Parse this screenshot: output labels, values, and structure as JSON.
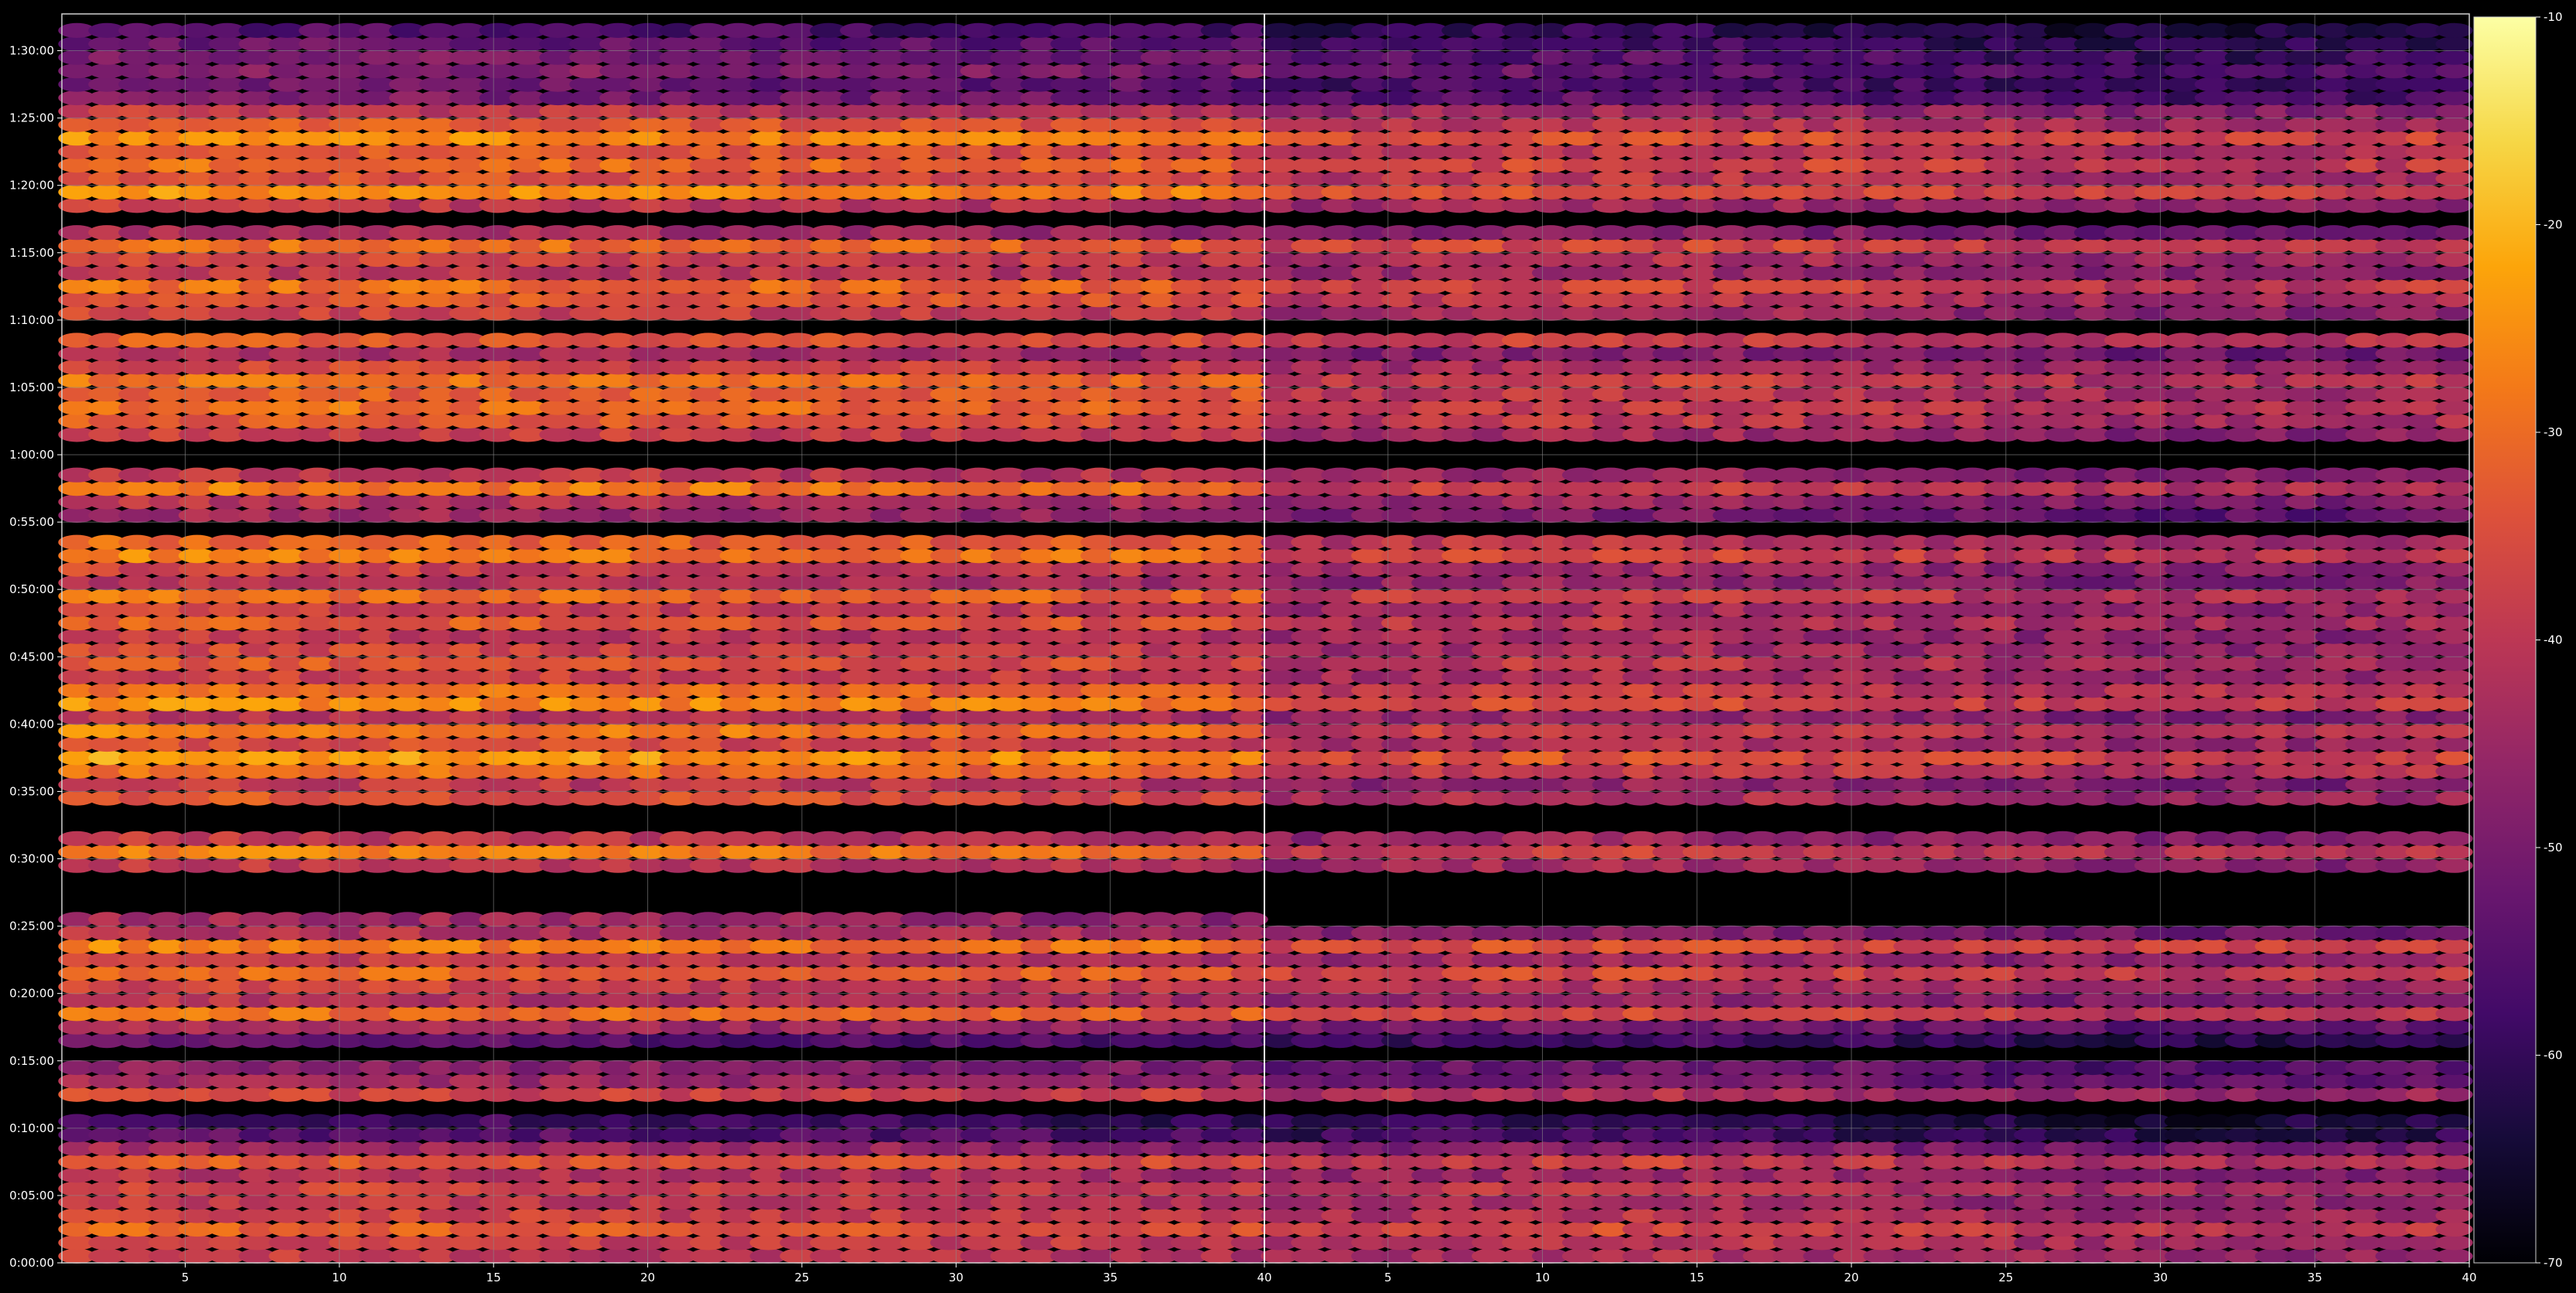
{
  "chart_data": {
    "type": "heatmap",
    "colormap": "inferno",
    "background": "#000000",
    "grid": true,
    "legend": "colorbar-right",
    "x_ticks": [
      5,
      10,
      15,
      20,
      25,
      30,
      35,
      40
    ],
    "x_domain": [
      1,
      40
    ],
    "y_tick_labels": [
      "0:00:00",
      "0:05:00",
      "0:10:00",
      "0:15:00",
      "0:20:00",
      "0:25:00",
      "0:30:00",
      "0:35:00",
      "0:40:00",
      "0:45:00",
      "0:50:00",
      "0:55:00",
      "1:00:00",
      "1:05:00",
      "1:10:00",
      "1:15:00",
      "1:20:00",
      "1:25:00",
      "1:30:00"
    ],
    "y_range_seconds": [
      0,
      5550
    ],
    "colorbar": {
      "ticks": [
        -70,
        -60,
        -50,
        -40,
        -30,
        -20,
        -10
      ],
      "range": [
        -70,
        -10
      ]
    },
    "panels": [
      {
        "name": "left",
        "x_range": [
          1,
          40
        ],
        "bands_minutes": [
          {
            "t": 0.5,
            "v": -40
          },
          {
            "t": 1.5,
            "v": -38
          },
          {
            "t": 2.5,
            "v": -33
          },
          {
            "t": 3.5,
            "v": -38
          },
          {
            "t": 4.5,
            "v": -40
          },
          {
            "t": 5.5,
            "v": -37
          },
          {
            "t": 6.5,
            "v": -42
          },
          {
            "t": 7.5,
            "v": -34
          },
          {
            "t": 8.5,
            "v": -45
          },
          {
            "t": 9.5,
            "v": -55
          },
          {
            "t": 10.5,
            "v": -58
          },
          {
            "t": 12.5,
            "v": -37
          },
          {
            "t": 13.5,
            "v": -45
          },
          {
            "t": 14.5,
            "v": -48
          },
          {
            "t": 16.5,
            "v": -55
          },
          {
            "t": 17.5,
            "v": -45
          },
          {
            "t": 18.5,
            "v": -30
          },
          {
            "t": 19.5,
            "v": -42
          },
          {
            "t": 20.5,
            "v": -38
          },
          {
            "t": 21.5,
            "v": -31
          },
          {
            "t": 22.5,
            "v": -40
          },
          {
            "t": 23.5,
            "v": -28
          },
          {
            "t": 24.5,
            "v": -42
          },
          {
            "t": 25.5,
            "v": -45
          },
          {
            "t": 29.5,
            "v": -40
          },
          {
            "t": 30.5,
            "v": -28
          },
          {
            "t": 31.5,
            "v": -40
          },
          {
            "t": 34.5,
            "v": -34
          },
          {
            "t": 35.5,
            "v": -40
          },
          {
            "t": 36.5,
            "v": -30
          },
          {
            "t": 37.5,
            "v": -24
          },
          {
            "t": 38.5,
            "v": -36
          },
          {
            "t": 39.5,
            "v": -28
          },
          {
            "t": 40.5,
            "v": -42
          },
          {
            "t": 41.5,
            "v": -26
          },
          {
            "t": 42.5,
            "v": -30
          },
          {
            "t": 43.5,
            "v": -38
          },
          {
            "t": 44.5,
            "v": -34
          },
          {
            "t": 45.5,
            "v": -37
          },
          {
            "t": 46.5,
            "v": -40
          },
          {
            "t": 47.5,
            "v": -33
          },
          {
            "t": 48.5,
            "v": -38
          },
          {
            "t": 49.5,
            "v": -30
          },
          {
            "t": 50.5,
            "v": -42
          },
          {
            "t": 51.5,
            "v": -38
          },
          {
            "t": 52.5,
            "v": -28
          },
          {
            "t": 53.5,
            "v": -32
          },
          {
            "t": 55.5,
            "v": -45
          },
          {
            "t": 56.5,
            "v": -42
          },
          {
            "t": 57.5,
            "v": -28
          },
          {
            "t": 58.5,
            "v": -40
          },
          {
            "t": 61.5,
            "v": -38
          },
          {
            "t": 62.5,
            "v": -34
          },
          {
            "t": 63.5,
            "v": -30
          },
          {
            "t": 64.5,
            "v": -32
          },
          {
            "t": 65.5,
            "v": -30
          },
          {
            "t": 66.5,
            "v": -37
          },
          {
            "t": 67.5,
            "v": -44
          },
          {
            "t": 68.5,
            "v": -34
          },
          {
            "t": 70.5,
            "v": -38
          },
          {
            "t": 71.5,
            "v": -33
          },
          {
            "t": 72.5,
            "v": -30
          },
          {
            "t": 73.5,
            "v": -40
          },
          {
            "t": 74.5,
            "v": -37
          },
          {
            "t": 75.5,
            "v": -30
          },
          {
            "t": 76.5,
            "v": -44
          },
          {
            "t": 78.5,
            "v": -40
          },
          {
            "t": 79.5,
            "v": -26
          },
          {
            "t": 80.5,
            "v": -35
          },
          {
            "t": 81.5,
            "v": -30
          },
          {
            "t": 82.5,
            "v": -34
          },
          {
            "t": 83.5,
            "v": -26
          },
          {
            "t": 84.5,
            "v": -33
          },
          {
            "t": 85.5,
            "v": -40
          },
          {
            "t": 86.5,
            "v": -50
          },
          {
            "t": 87.5,
            "v": -52
          },
          {
            "t": 88.5,
            "v": -48
          },
          {
            "t": 89.5,
            "v": -50
          },
          {
            "t": 90.5,
            "v": -53
          },
          {
            "t": 91.5,
            "v": -56
          }
        ]
      },
      {
        "name": "right",
        "x_range": [
          1,
          40
        ],
        "bands_minutes": [
          {
            "t": 0.5,
            "v": -44
          },
          {
            "t": 1.5,
            "v": -42
          },
          {
            "t": 2.5,
            "v": -38
          },
          {
            "t": 3.5,
            "v": -43
          },
          {
            "t": 4.5,
            "v": -45
          },
          {
            "t": 5.5,
            "v": -42
          },
          {
            "t": 6.5,
            "v": -47
          },
          {
            "t": 7.5,
            "v": -40
          },
          {
            "t": 8.5,
            "v": -50
          },
          {
            "t": 9.5,
            "v": -60
          },
          {
            "t": 10.5,
            "v": -62
          },
          {
            "t": 12.5,
            "v": -44
          },
          {
            "t": 13.5,
            "v": -52
          },
          {
            "t": 14.5,
            "v": -54
          },
          {
            "t": 16.5,
            "v": -60
          },
          {
            "t": 17.5,
            "v": -52
          },
          {
            "t": 18.5,
            "v": -38
          },
          {
            "t": 19.5,
            "v": -48
          },
          {
            "t": 20.5,
            "v": -44
          },
          {
            "t": 21.5,
            "v": -38
          },
          {
            "t": 22.5,
            "v": -46
          },
          {
            "t": 23.5,
            "v": -36
          },
          {
            "t": 24.5,
            "v": -50
          },
          {
            "t": 29.5,
            "v": -46
          },
          {
            "t": 30.5,
            "v": -40
          },
          {
            "t": 31.5,
            "v": -47
          },
          {
            "t": 34.5,
            "v": -44
          },
          {
            "t": 35.5,
            "v": -48
          },
          {
            "t": 36.5,
            "v": -40
          },
          {
            "t": 37.5,
            "v": -36
          },
          {
            "t": 38.5,
            "v": -44
          },
          {
            "t": 39.5,
            "v": -40
          },
          {
            "t": 40.5,
            "v": -48
          },
          {
            "t": 41.5,
            "v": -38
          },
          {
            "t": 42.5,
            "v": -40
          },
          {
            "t": 43.5,
            "v": -45
          },
          {
            "t": 44.5,
            "v": -42
          },
          {
            "t": 45.5,
            "v": -45
          },
          {
            "t": 46.5,
            "v": -46
          },
          {
            "t": 47.5,
            "v": -42
          },
          {
            "t": 48.5,
            "v": -45
          },
          {
            "t": 49.5,
            "v": -40
          },
          {
            "t": 50.5,
            "v": -48
          },
          {
            "t": 51.5,
            "v": -46
          },
          {
            "t": 52.5,
            "v": -38
          },
          {
            "t": 53.5,
            "v": -42
          },
          {
            "t": 55.5,
            "v": -52
          },
          {
            "t": 56.5,
            "v": -48
          },
          {
            "t": 57.5,
            "v": -40
          },
          {
            "t": 58.5,
            "v": -47
          },
          {
            "t": 61.5,
            "v": -46
          },
          {
            "t": 62.5,
            "v": -42
          },
          {
            "t": 63.5,
            "v": -40
          },
          {
            "t": 64.5,
            "v": -42
          },
          {
            "t": 65.5,
            "v": -40
          },
          {
            "t": 66.5,
            "v": -45
          },
          {
            "t": 67.5,
            "v": -50
          },
          {
            "t": 68.5,
            "v": -40
          },
          {
            "t": 70.5,
            "v": -46
          },
          {
            "t": 71.5,
            "v": -42
          },
          {
            "t": 72.5,
            "v": -38
          },
          {
            "t": 73.5,
            "v": -46
          },
          {
            "t": 74.5,
            "v": -44
          },
          {
            "t": 75.5,
            "v": -38
          },
          {
            "t": 76.5,
            "v": -50
          },
          {
            "t": 78.5,
            "v": -46
          },
          {
            "t": 79.5,
            "v": -36
          },
          {
            "t": 80.5,
            "v": -42
          },
          {
            "t": 81.5,
            "v": -38
          },
          {
            "t": 82.5,
            "v": -42
          },
          {
            "t": 83.5,
            "v": -36
          },
          {
            "t": 84.5,
            "v": -42
          },
          {
            "t": 85.5,
            "v": -46
          },
          {
            "t": 86.5,
            "v": -56
          },
          {
            "t": 87.5,
            "v": -58
          },
          {
            "t": 88.5,
            "v": -55
          },
          {
            "t": 89.5,
            "v": -57
          },
          {
            "t": 90.5,
            "v": -60
          },
          {
            "t": 91.5,
            "v": -62
          }
        ]
      }
    ]
  }
}
